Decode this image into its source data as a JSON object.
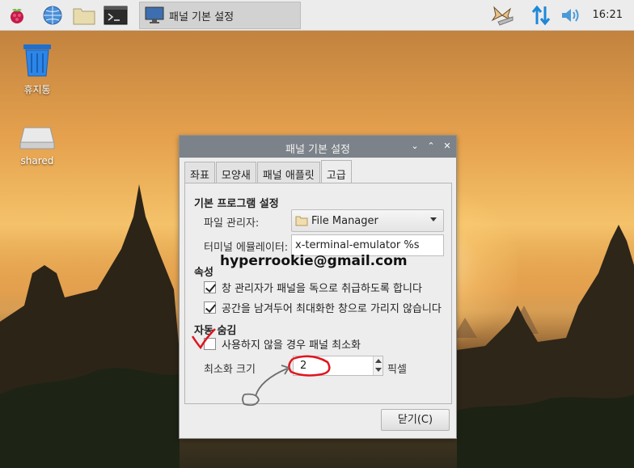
{
  "taskbar": {
    "active_task_label": "패널 기본 설정",
    "clock": "16:21"
  },
  "desktop": {
    "icons": [
      {
        "label": "휴지통"
      },
      {
        "label": "shared"
      }
    ]
  },
  "dialog": {
    "title": "패널 기본 설정",
    "tabs": [
      {
        "label": "좌표"
      },
      {
        "label": "모양새"
      },
      {
        "label": "패널 애플릿"
      },
      {
        "label": "고급"
      }
    ],
    "active_tab": "고급",
    "section_default_apps": "기본 프로그램 설정",
    "file_manager_label": "파일 관리자:",
    "file_manager_value": "File Manager",
    "terminal_label": "터미널 에뮬레이터:",
    "terminal_value": "x-terminal-emulator %s",
    "section_properties": "속성",
    "check1_label": "창 관리자가 패널을 독으로 취급하도록 합니다",
    "check2_label": "공간을 남겨두어 최대화한 창으로 가리지 않습니다",
    "section_autohide": "자동 숨김",
    "check3_label": "사용하지 않을 경우 패널 최소화",
    "min_size_label": "최소화 크기",
    "min_size_value": "2",
    "min_size_unit": "픽셀",
    "close_button": "닫기(C)"
  },
  "overlay": {
    "email": "hyperrookie@gmail.com"
  },
  "colors": {
    "titlebar": "#7b8289",
    "annotation_red": "#e0141e",
    "annotation_gray": "#6e6e6e"
  }
}
